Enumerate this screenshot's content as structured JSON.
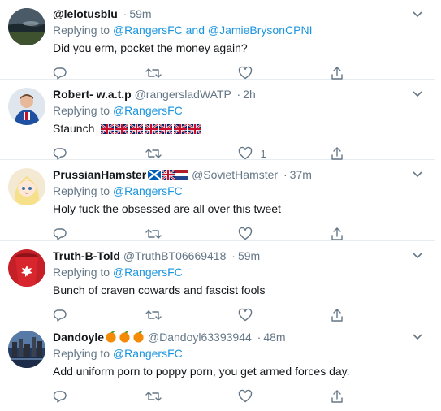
{
  "tweets": [
    {
      "name": "@lelotusblu",
      "handle": "",
      "time": "59m",
      "replying_prefix": "Replying to",
      "mentions": [
        "@RangersFC",
        "and",
        "@JamieBrysonCPNI"
      ],
      "text": "Did you erm, pocket the money again?",
      "like_count": ""
    },
    {
      "name": "Robert- w.a.t.p",
      "handle": "@rangersladWATP",
      "time": "2h",
      "replying_prefix": "Replying to",
      "mentions": [
        "@RangersFC"
      ],
      "text": "Staunch",
      "like_count": "1"
    },
    {
      "name": "PrussianHamster",
      "handle": "@SovietHamster",
      "time": "37m",
      "replying_prefix": "Replying to",
      "mentions": [
        "@RangersFC"
      ],
      "text": "Holy fuck the obsessed are all over this tweet",
      "like_count": ""
    },
    {
      "name": "Truth-B-Told",
      "handle": "@TruthBT06669418",
      "time": "59m",
      "replying_prefix": "Replying to",
      "mentions": [
        "@RangersFC"
      ],
      "text": "Bunch of craven cowards and fascist fools",
      "like_count": ""
    },
    {
      "name": "Dandoyle",
      "handle": "@Dandoyl63393944",
      "time": "48m",
      "replying_prefix": "Replying to",
      "mentions": [
        "@RangersFC"
      ],
      "text": "Add uniform porn to poppy porn, you get armed forces day.",
      "like_count": ""
    }
  ],
  "separator": "·",
  "icons": {
    "reply": "reply-icon",
    "retweet": "retweet-icon",
    "like": "heart-icon",
    "share": "share-icon",
    "more": "chevron-down-icon"
  },
  "colors": {
    "link": "#1b95e0",
    "muted": "#657786",
    "text": "#14171a",
    "divider": "#e6ecf0"
  }
}
